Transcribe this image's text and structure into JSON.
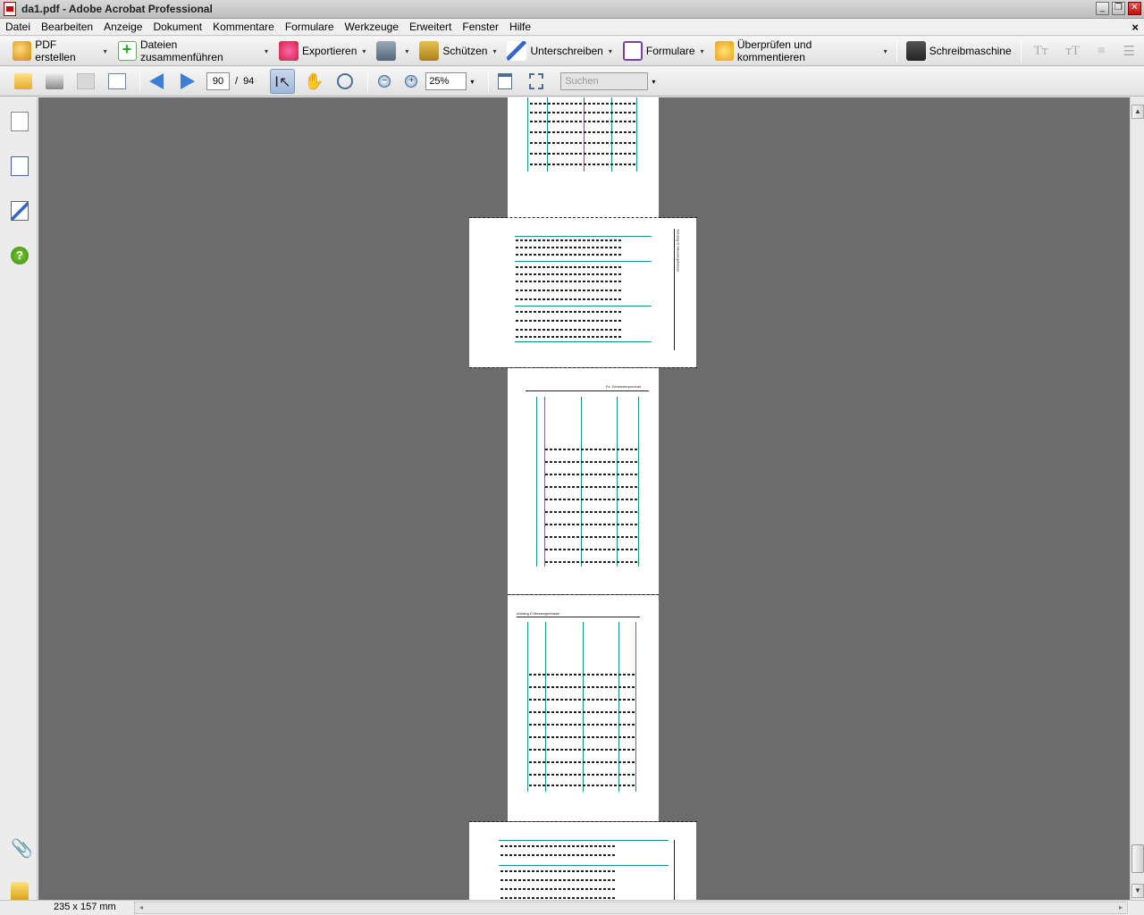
{
  "window": {
    "title": "da1.pdf - Adobe Acrobat Professional",
    "minimize": "_",
    "restore": "❐",
    "close": "✕"
  },
  "menu": {
    "items": [
      "Datei",
      "Bearbeiten",
      "Anzeige",
      "Dokument",
      "Kommentare",
      "Formulare",
      "Werkzeuge",
      "Erweitert",
      "Fenster",
      "Hilfe"
    ],
    "doc_close": "×"
  },
  "tasks": {
    "create_pdf": "PDF erstellen",
    "combine": "Dateien zusammenführen",
    "export": "Exportieren",
    "secure": "Schützen",
    "sign": "Unterschreiben",
    "forms": "Formulare",
    "review": "Überprüfen und kommentieren",
    "typewriter": "Schreibmaschine",
    "dropdown_caret": "▾",
    "text_tools": [
      "Tт",
      "тT",
      "≡",
      "☰"
    ]
  },
  "toolbar": {
    "current_page": "90",
    "page_separator": "/",
    "total_pages": "94",
    "zoom": "25%",
    "zoom_out": "−",
    "zoom_in": "+",
    "search_placeholder": "Suchen",
    "select_glyph": "I↖",
    "hand_glyph": "✋",
    "dropdown_caret": "▾"
  },
  "nav": {
    "help_glyph": "?",
    "attach_glyph": "📎"
  },
  "pages": {
    "page_header_right": "Ez. Schwemmprodukt",
    "page_header_left": "Anhang D Messergebnisse",
    "rotated_title": "Anhang D Messergebnisse"
  },
  "scrollbar": {
    "up": "▲",
    "down": "▼",
    "left": "◂",
    "right": "▸"
  },
  "status": {
    "page_size": "235 x 157 mm"
  }
}
